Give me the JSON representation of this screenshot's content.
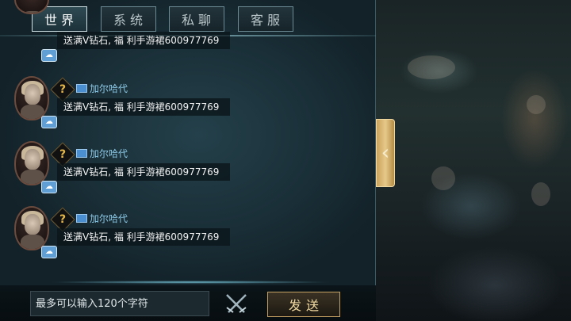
{
  "tabs": [
    {
      "label": "世界",
      "active": true
    },
    {
      "label": "系统",
      "active": false
    },
    {
      "label": "私聊",
      "active": false
    },
    {
      "label": "客服",
      "active": false
    }
  ],
  "messages": [
    {
      "name": "",
      "text": "送满V钻石, 福 利手游裙600977769"
    },
    {
      "name": "加尔哈代",
      "text": "送满V钻石, 福 利手游裙600977769"
    },
    {
      "name": "加尔哈代",
      "text": "送满V钻石, 福 利手游裙600977769"
    },
    {
      "name": "加尔哈代",
      "text": "送满V钻石, 福 利手游裙600977769"
    }
  ],
  "vip_badge_symbol": "?",
  "input": {
    "placeholder": "最多可以输入120个字符"
  },
  "send_label": "发送",
  "collapse_arrow": "‹",
  "colors": {
    "name": "#8cc9e6",
    "send_text": "#f0d9a0",
    "tab_active_border": "#cfe1e4"
  }
}
